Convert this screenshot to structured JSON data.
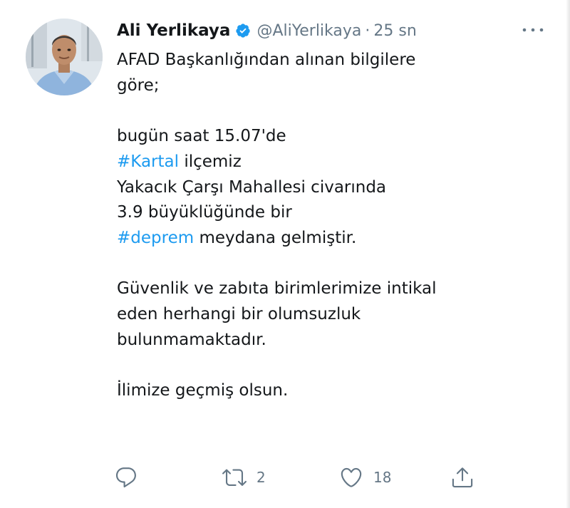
{
  "tweet": {
    "author_name": "Ali Yerlikaya",
    "handle": "@AliYerlikaya",
    "separator": "·",
    "timestamp": "25 sn",
    "verified": true,
    "lines": {
      "l1": "AFAD Başkanlığından alınan bilgilere",
      "l2": "göre;",
      "l3": "bugün saat 15.07'de",
      "l4_tag": "#Kartal",
      "l4_rest": " ilçemiz",
      "l5": "Yakacık Çarşı Mahallesi civarında",
      "l6": "3.9 büyüklüğünde bir",
      "l7_tag": "#deprem",
      "l7_rest": " meydana gelmiştir.",
      "l8": "Güvenlik ve zabıta birimlerimize intikal",
      "l9": "eden herhangi bir olumsuzluk",
      "l10": "bulunmamaktadır.",
      "l11": "İlimize geçmiş olsun."
    },
    "actions": {
      "reply_icon": "reply-icon",
      "retweet_icon": "retweet-icon",
      "retweet_count": "2",
      "like_icon": "heart-icon",
      "like_count": "18",
      "share_icon": "share-icon"
    }
  },
  "colors": {
    "text": "#14171a",
    "secondary": "#657786",
    "hashtag": "#1d9bf0",
    "verified_badge": "#1d9bf0"
  }
}
